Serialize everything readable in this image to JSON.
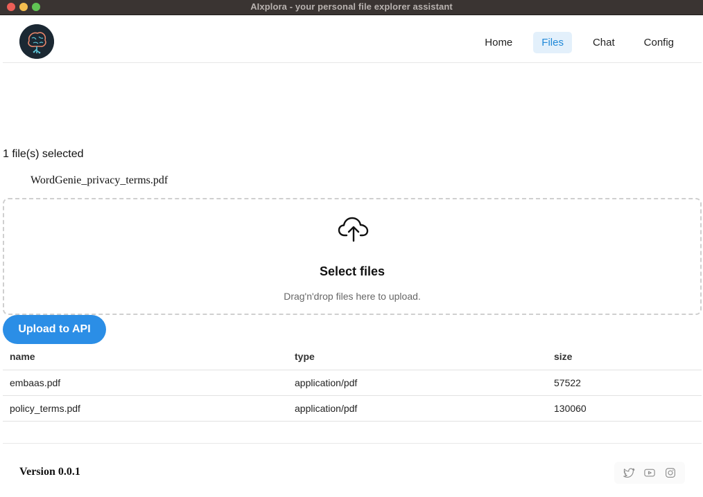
{
  "window": {
    "title": "AIxplora - your personal file explorer assistant"
  },
  "nav": {
    "items": [
      {
        "label": "Home"
      },
      {
        "label": "Files",
        "active": true
      },
      {
        "label": "Chat"
      },
      {
        "label": "Config"
      }
    ],
    "accent": "#1e88d8"
  },
  "selection": {
    "count_text": "1 file(s) selected",
    "files": [
      "WordGenie_privacy_terms.pdf"
    ]
  },
  "dropzone": {
    "icon": "cloud-upload-icon",
    "title": "Select files",
    "subtitle": "Drag'n'drop files here to upload."
  },
  "upload_button": {
    "label": "Upload to API",
    "color": "#2b8ee6"
  },
  "table": {
    "headers": [
      "name",
      "type",
      "size"
    ],
    "rows": [
      [
        "embaas.pdf",
        "application/pdf",
        "57522"
      ],
      [
        "policy_terms.pdf",
        "application/pdf",
        "130060"
      ]
    ]
  },
  "footer": {
    "version": "Version 0.0.1",
    "socials": [
      "twitter-icon",
      "youtube-icon",
      "instagram-icon"
    ]
  }
}
